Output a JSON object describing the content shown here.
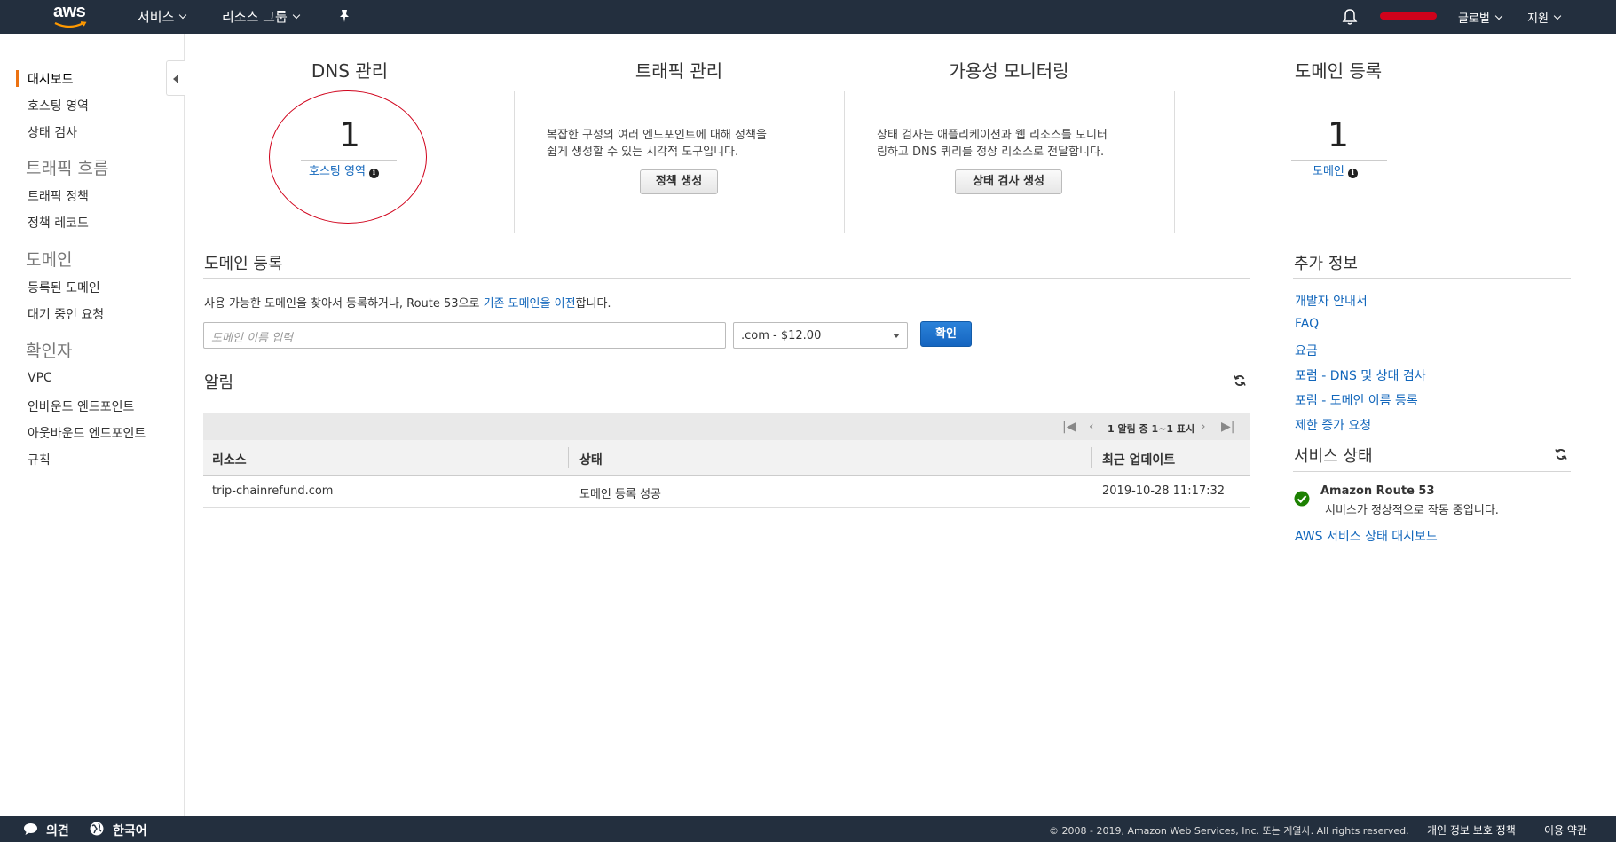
{
  "topnav": {
    "logo": "aws",
    "services": "서비스",
    "resource_groups": "리소스 그룹",
    "region": "글로벌",
    "support": "지원"
  },
  "sidebar": {
    "items": [
      {
        "label": "대시보드",
        "active": true
      },
      {
        "label": "호스팅 영역"
      },
      {
        "label": "상태 검사"
      }
    ],
    "traffic_head": "트래픽 흐름",
    "traffic_items": [
      "트래픽 정책",
      "정책 레코드"
    ],
    "domain_head": "도메인",
    "domain_items": [
      "등록된 도메인",
      "대기 중인 요청"
    ],
    "resolver_head": "확인자",
    "resolver_items": [
      "VPC",
      "인바운드 엔드포인트",
      "아웃바운드 엔드포인트",
      "규칙"
    ]
  },
  "summary": {
    "dns": {
      "title": "DNS 관리",
      "count": "1",
      "link": "호스팅 영역"
    },
    "traffic": {
      "title": "트래픽 관리",
      "desc_line1": "복잡한 구성의 여러 엔드포인트에 대해 정책을",
      "desc_line2": "쉽게 생성할 수 있는 시각적 도구입니다.",
      "button": "정책 생성"
    },
    "availability": {
      "title": "가용성 모니터링",
      "desc_line1": "상태 검사는 애플리케이션과 웹 리소스를 모니터",
      "desc_line2": "링하고 DNS 쿼리를 정상 리소스로 전달합니다.",
      "button": "상태 검사 생성"
    },
    "domain": {
      "title": "도메인 등록",
      "count": "1",
      "link": "도메인"
    }
  },
  "register": {
    "title": "도메인 등록",
    "text_before": "사용 가능한 도메인을 찾아서 등록하거나, Route 53으로 ",
    "link": "기존 도메인을 이전",
    "text_after": "합니다.",
    "input_placeholder": "도메인 이름 입력",
    "tld_select": ".com - $12.00",
    "confirm": "확인"
  },
  "alerts": {
    "title": "알림",
    "pager": "1 알림 중 1~1 표시",
    "columns": [
      "리소스",
      "상태",
      "최근 업데이트"
    ],
    "rows": [
      {
        "resource": "trip-chainrefund.com",
        "status": "도메인 등록 성공",
        "updated": "2019-10-28 11:17:32"
      }
    ]
  },
  "more_info": {
    "title": "추가 정보",
    "links": [
      "개발자 안내서",
      "FAQ",
      "요금",
      "포럼 - DNS 및 상태 검사",
      "포럼 - 도메인 이름 등록",
      "제한 증가 요청"
    ]
  },
  "service_status": {
    "title": "서비스 상태",
    "service_name": "Amazon Route 53",
    "service_msg": "서비스가 정상적으로 작동 중입니다.",
    "dashboard_link": "AWS 서비스 상태 대시보드",
    "ok_color": "#1d8102"
  },
  "footer": {
    "feedback": "의견",
    "language": "한국어",
    "copyright": "© 2008 - 2019, Amazon Web Services, Inc. 또는 계열사. All rights reserved.",
    "privacy": "개인 정보 보호 정책",
    "terms": "이용 약관"
  }
}
